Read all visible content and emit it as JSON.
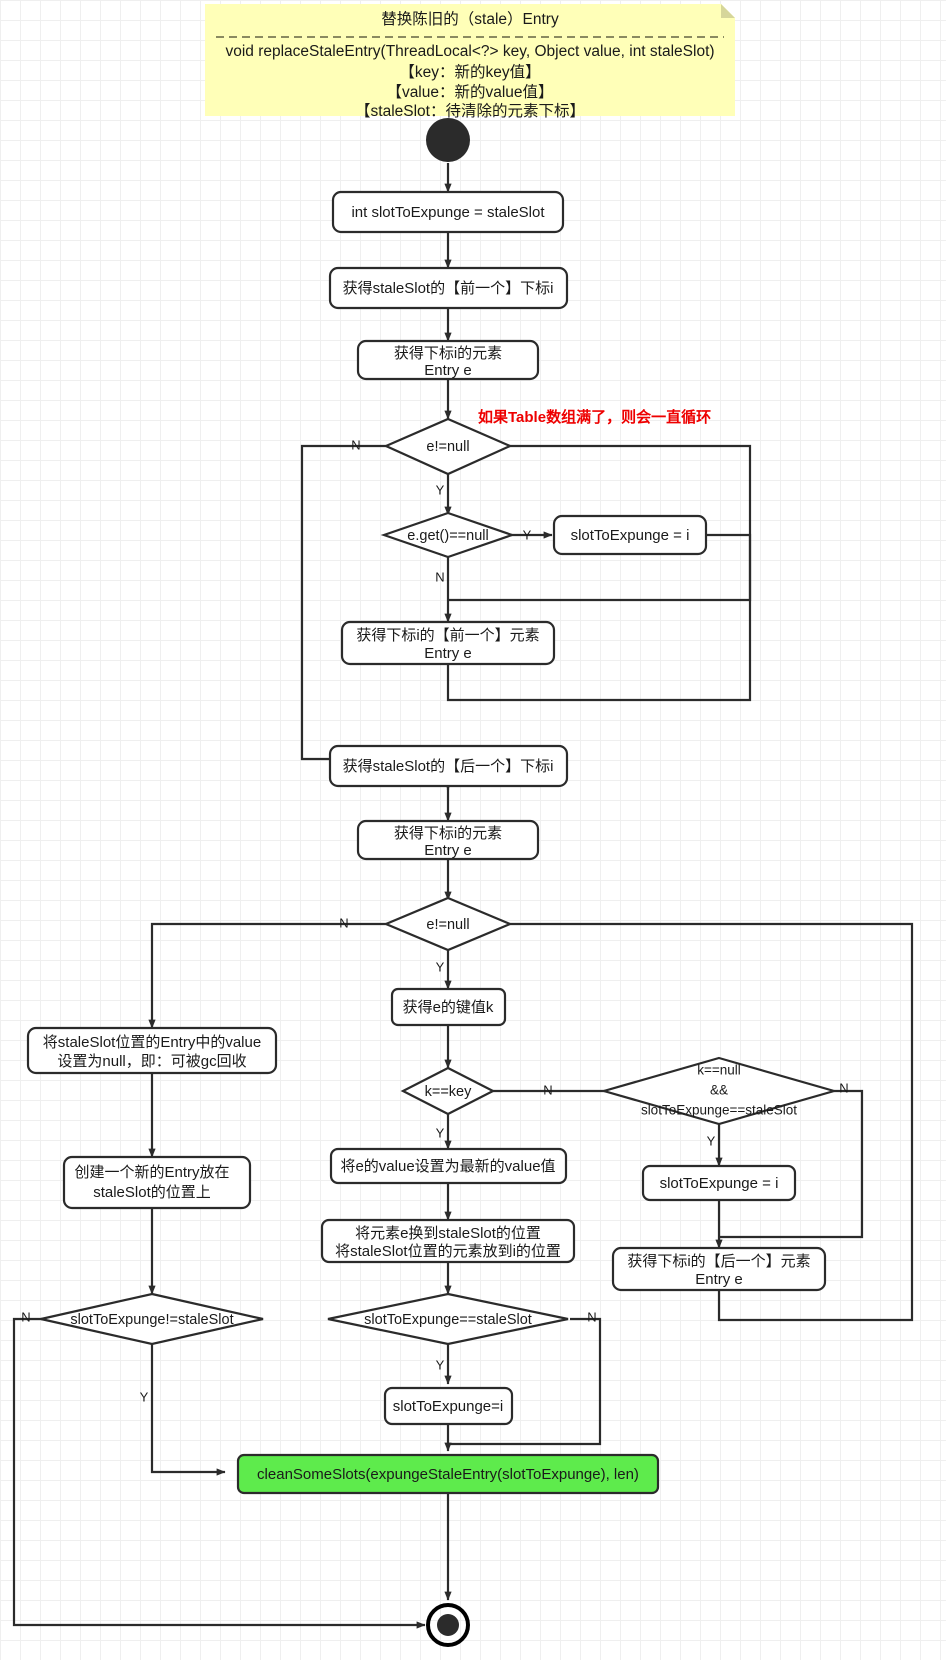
{
  "diagram": {
    "title_note": {
      "heading": "替换陈旧的（stale）Entry",
      "line1": "void replaceStaleEntry(ThreadLocal<?> key, Object value, int staleSlot)",
      "line2": "【key：新的key值】",
      "line3": "【value：新的value值】",
      "line4": "【staleSlot：待清除的元素下标】"
    },
    "annotation_red": "如果Table数组满了，则会一直循环",
    "colors": {
      "note_bg": "#ffffb8",
      "highlight_green": "#5eeb4c",
      "stroke": "#2b2b2b",
      "annotation_red": "#ee0000",
      "grid_line": "#e3e3e3"
    },
    "nodes": {
      "start": "start-node",
      "n1": "int slotToExpunge = staleSlot",
      "n2": "获得staleSlot的【前一个】下标i",
      "n3_l1": "获得下标i的元素",
      "n3_l2": "Entry e",
      "d1": "e!=null",
      "d2": "e.get()==null",
      "n4": "slotToExpunge = i",
      "n5_l1": "获得下标i的【前一个】元素",
      "n5_l2": "Entry e",
      "n6": "获得staleSlot的【后一个】下标i",
      "n7_l1": "获得下标i的元素",
      "n7_l2": "Entry e",
      "d3": "e!=null",
      "n8": "获得e的键值k",
      "d4": "k==key",
      "d5_l1": "k==null",
      "d5_l2": "&&",
      "d5_l3": "slotToExpunge==staleSlot",
      "n9": "slotToExpunge = i",
      "n10_l1": "获得下标i的【后一个】元素",
      "n10_l2": "Entry e",
      "n11": "将e的value设置为最新的value值",
      "n12_l1": "将元素e换到staleSlot的位置",
      "n12_l2": "将staleSlot位置的元素放到i的位置",
      "n13_l1": "将staleSlot位置的Entry中的value",
      "n13_l2": "设置为null，即：可被gc回收",
      "n14_l1": "创建一个新的Entry放在",
      "n14_l2": "staleSlot的位置上",
      "d6": "slotToExpunge!=staleSlot",
      "d7": "slotToExpunge==staleSlot",
      "n15": "slotToExpunge=i",
      "n16": "cleanSomeSlots(expungeStaleEntry(slotToExpunge), len)",
      "end": "end-node"
    },
    "edge_labels": {
      "d1_no": "N",
      "d1_yes": "Y",
      "d2_yes": "Y",
      "d2_no": "N",
      "d3_no": "N",
      "d3_yes": "Y",
      "d4_no": "N",
      "d4_yes": "Y",
      "d5_yes": "Y",
      "d5_no": "N",
      "d6_no": "N",
      "d6_yes": "Y",
      "d7_yes": "Y",
      "d7_no": "N"
    }
  }
}
